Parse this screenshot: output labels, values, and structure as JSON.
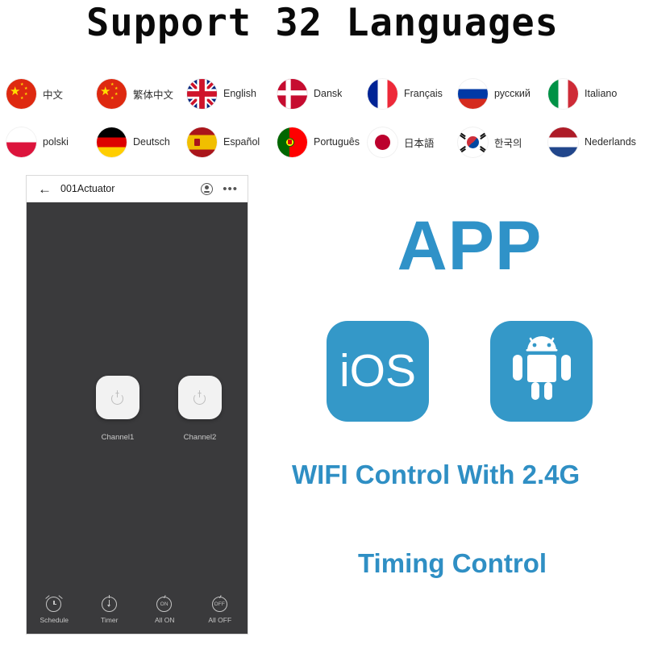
{
  "page": {
    "title": "Support 32 Languages",
    "background": "#ffffff",
    "accent_blue": "#3498c8"
  },
  "languages": {
    "row1": [
      {
        "label": "中文",
        "flag": "flag-china-icon",
        "country": "cn"
      },
      {
        "label": "繁体中文",
        "flag": "flag-china-icon",
        "country": "cn"
      },
      {
        "label": "English",
        "flag": "flag-uk-icon",
        "country": "gb"
      },
      {
        "label": "Dansk",
        "flag": "flag-denmark-icon",
        "country": "dk"
      },
      {
        "label": "Français",
        "flag": "flag-france-icon",
        "country": "fr"
      },
      {
        "label": "русский",
        "flag": "flag-russia-icon",
        "country": "ru"
      },
      {
        "label": "Italiano",
        "flag": "flag-italy-icon",
        "country": "it"
      }
    ],
    "row2": [
      {
        "label": "polski",
        "flag": "flag-poland-icon",
        "country": "pl"
      },
      {
        "label": "Deutsch",
        "flag": "flag-germany-icon",
        "country": "de"
      },
      {
        "label": "Español",
        "flag": "flag-spain-icon",
        "country": "es"
      },
      {
        "label": "Português",
        "flag": "flag-portugal-icon",
        "country": "pt"
      },
      {
        "label": "日本語",
        "flag": "flag-japan-icon",
        "country": "jp"
      },
      {
        "label": "한국의",
        "flag": "flag-korea-icon",
        "country": "kr"
      },
      {
        "label": "Nederlands",
        "flag": "flag-netherlands-icon",
        "country": "nl"
      }
    ]
  },
  "phone": {
    "header": {
      "back_icon": "back-arrow-icon",
      "title": "001Actuator",
      "mic_icon": "voice-mic-icon",
      "menu_icon": "more-options-icon",
      "menu_glyph": "•••"
    },
    "channels": [
      {
        "label": "Channel1",
        "icon": "power-icon"
      },
      {
        "label": "Channel2",
        "icon": "power-icon"
      }
    ],
    "bottom_bar": [
      {
        "label": "Schedule",
        "icon": "alarm-clock-icon",
        "text": ""
      },
      {
        "label": "Timer",
        "icon": "stopwatch-icon",
        "text": ""
      },
      {
        "label": "All ON",
        "icon": "all-on-icon",
        "text": "ON"
      },
      {
        "label": "All OFF",
        "icon": "all-off-icon",
        "text": "OFF"
      }
    ],
    "body_color": "#3a3a3c"
  },
  "promo": {
    "app_word": "APP",
    "platforms": [
      {
        "name": "iOS",
        "icon": "ios-icon"
      },
      {
        "name": "Android",
        "icon": "android-robot-icon"
      }
    ],
    "wifi_line": "WIFI Control With 2.4G",
    "timing_line": "Timing Control"
  }
}
